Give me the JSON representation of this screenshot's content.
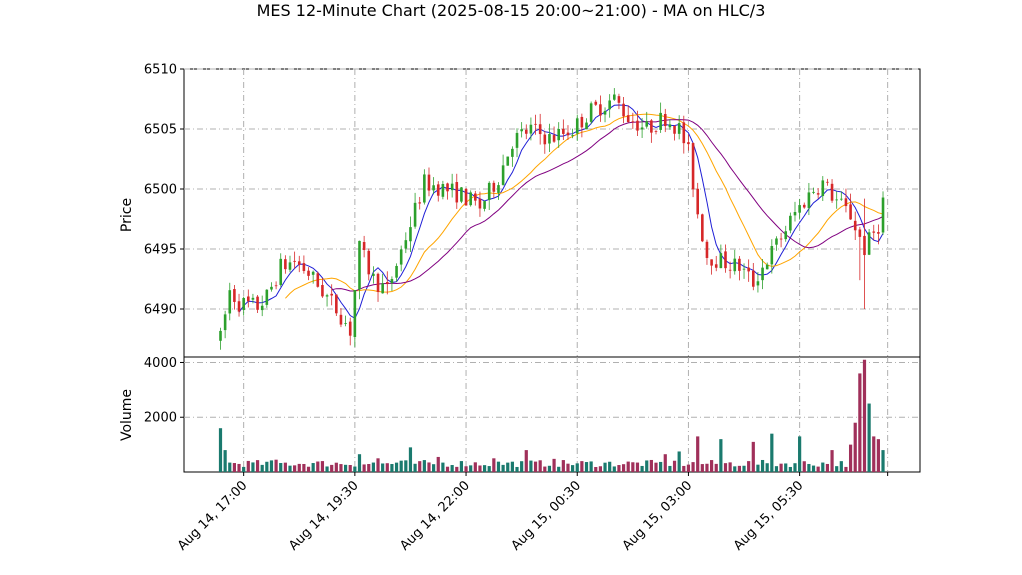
{
  "chart_data": {
    "type": "candlestick",
    "title": "MES 12-Minute Chart (2025-08-15 20:00~21:00) - MA on HLC/3",
    "price_panel": {
      "ylabel": "Price",
      "ylim": [
        6486,
        6510
      ],
      "yticks": [
        6490,
        6495,
        6500,
        6505,
        6510
      ],
      "ytick_labels": [
        "6490",
        "6495",
        "6500",
        "6505",
        "6510"
      ],
      "grid": true
    },
    "volume_panel": {
      "ylabel": "Volume",
      "ylim": [
        0,
        4200
      ],
      "yticks": [
        2000,
        4000
      ],
      "ytick_labels": [
        "2000",
        "4000"
      ],
      "grid": true
    },
    "x_axis": {
      "start": "Aug 14, 16:00",
      "end": "Aug 15, 07:24",
      "interval_minutes": 12,
      "tick_labels": [
        "Aug 14, 17:00",
        "Aug 14, 19:30",
        "Aug 14, 22:00",
        "Aug 15, 00:30",
        "Aug 15, 03:00",
        "Aug 15, 05:30"
      ]
    },
    "colors": {
      "up": "#2ca02c",
      "down": "#d62728",
      "ma_fast": "#1f1fd6",
      "ma_mid": "#ffa500",
      "ma_slow": "#800080",
      "vol_up": "#1a7a6e",
      "vol_down": "#a0305a"
    },
    "price_anchors": [
      [
        0,
        6487.5
      ],
      [
        2,
        6491.5
      ],
      [
        4,
        6490.5
      ],
      [
        8,
        6490.2
      ],
      [
        10,
        6491.0
      ],
      [
        13,
        6493.5
      ],
      [
        16,
        6494.0
      ],
      [
        19,
        6493.0
      ],
      [
        23,
        6491.0
      ],
      [
        26,
        6489.5
      ],
      [
        28,
        6488.2
      ],
      [
        30,
        6495.0
      ],
      [
        33,
        6492.5
      ],
      [
        36,
        6491.5
      ],
      [
        40,
        6496.0
      ],
      [
        44,
        6500.5
      ],
      [
        47,
        6500.2
      ],
      [
        52,
        6499.5
      ],
      [
        56,
        6498.5
      ],
      [
        60,
        6501.0
      ],
      [
        63,
        6504.0
      ],
      [
        67,
        6505.0
      ],
      [
        71,
        6504.2
      ],
      [
        76,
        6505.0
      ],
      [
        80,
        6506.5
      ],
      [
        85,
        6507.5
      ],
      [
        88,
        6506.0
      ],
      [
        92,
        6505.0
      ],
      [
        96,
        6506.0
      ],
      [
        99,
        6505.0
      ],
      [
        101,
        6503.0
      ],
      [
        103,
        6498.0
      ],
      [
        105,
        6494.5
      ],
      [
        108,
        6494.0
      ],
      [
        112,
        6493.5
      ],
      [
        115,
        6492.2
      ],
      [
        117,
        6493.5
      ],
      [
        121,
        6496.0
      ],
      [
        124,
        6498.0
      ],
      [
        128,
        6500.0
      ],
      [
        130,
        6500.5
      ],
      [
        133,
        6499.0
      ],
      [
        136,
        6497.8
      ],
      [
        139,
        6495.0
      ],
      [
        142,
        6497.0
      ],
      [
        143,
        6499.0
      ]
    ],
    "volume_baseline": 180,
    "volume_spikes": [
      [
        0,
        1600
      ],
      [
        1,
        800
      ],
      [
        12,
        450
      ],
      [
        30,
        650
      ],
      [
        34,
        500
      ],
      [
        41,
        900
      ],
      [
        47,
        550
      ],
      [
        59,
        500
      ],
      [
        66,
        800
      ],
      [
        72,
        480
      ],
      [
        96,
        650
      ],
      [
        99,
        750
      ],
      [
        103,
        1300
      ],
      [
        108,
        1200
      ],
      [
        115,
        1100
      ],
      [
        119,
        1400
      ],
      [
        125,
        1300
      ],
      [
        132,
        800
      ],
      [
        136,
        1000
      ],
      [
        137,
        1800
      ],
      [
        138,
        3600
      ],
      [
        139,
        4100
      ],
      [
        140,
        2500
      ],
      [
        141,
        1300
      ],
      [
        142,
        1200
      ],
      [
        143,
        800
      ]
    ],
    "ma_windows": [
      5,
      15,
      25
    ]
  }
}
